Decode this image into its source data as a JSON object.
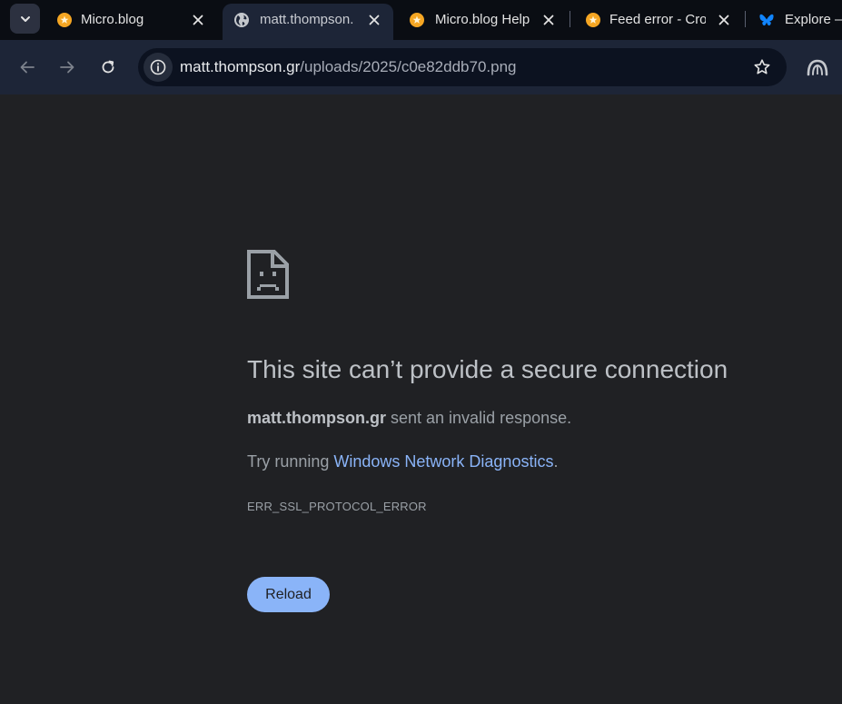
{
  "tabs": [
    {
      "title": "Micro.blog",
      "favicon": "microblog-icon",
      "active": false
    },
    {
      "title": "matt.thompson.",
      "favicon": "globe-icon",
      "active": true
    },
    {
      "title": "Micro.blog Help",
      "favicon": "microblog-icon",
      "active": false
    },
    {
      "title": "Feed error - Cro",
      "favicon": "microblog-icon",
      "active": false
    },
    {
      "title": "Explore —",
      "favicon": "bluesky-butterfly-icon",
      "active": false
    }
  ],
  "address_bar": {
    "host": "matt.thompson.gr",
    "path": "/uploads/2025/c0e82ddb70.png"
  },
  "error_page": {
    "heading": "This site can’t provide a secure connection",
    "host": "matt.thompson.gr",
    "description": " sent an invalid response.",
    "suggestion_prefix": "Try running ",
    "suggestion_link": "Windows Network Diagnostics",
    "suggestion_suffix": ".",
    "error_code": "ERR_SSL_PROTOCOL_ERROR",
    "reload_label": "Reload"
  },
  "colors": {
    "page_background": "#202124",
    "tabstrip_background": "#0a0d13",
    "toolbar_background": "#1d2537",
    "link": "#8ab4f8",
    "reload_button": "#8ab4f8",
    "microblog_favicon": "#f5a623",
    "bluesky_favicon": "#1185fe"
  }
}
